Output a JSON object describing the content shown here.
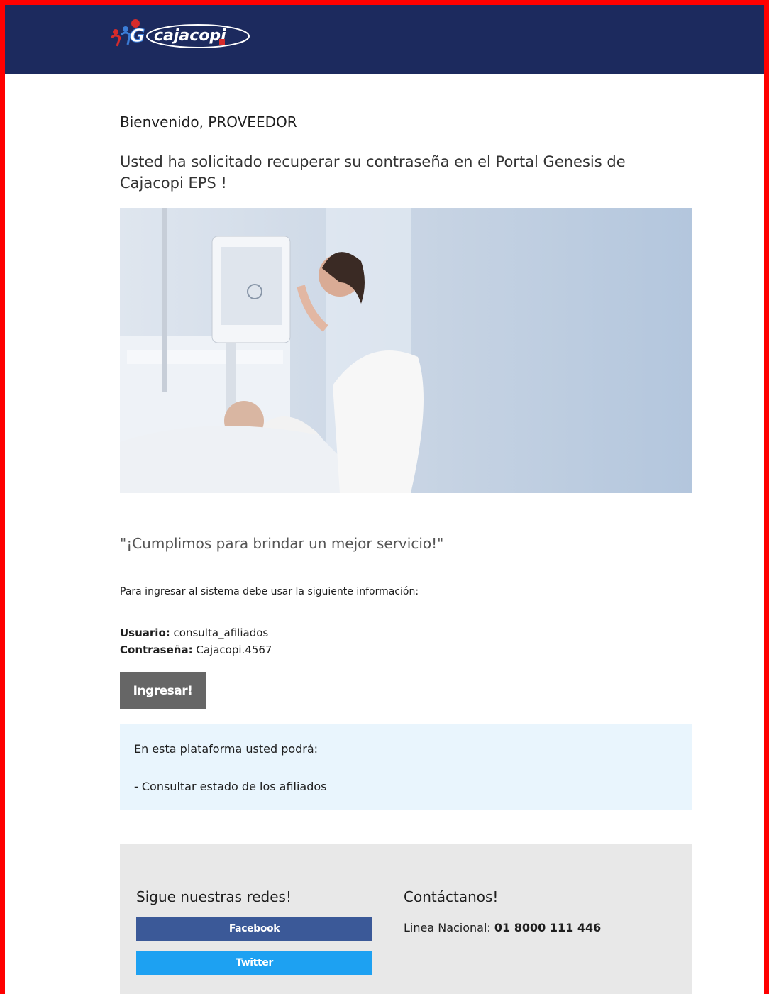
{
  "header": {
    "logo_text": "cajacopi",
    "logo_initial": "G",
    "brand_color": "#1c2a5e"
  },
  "email": {
    "greeting": "Bienvenido, PROVEEDOR",
    "intro": "Usted ha solicitado recuperar su contraseña en el Portal Genesis de Cajacopi EPS !",
    "slogan": "\"¡Cumplimos para brindar un mejor servicio!\"",
    "instructions": "Para ingresar al sistema debe usar la siguiente información:",
    "user_label": "Usuario:",
    "user_value": "consulta_afiliados",
    "password_label": "Contraseña:",
    "password_value": "Cajacopi.4567",
    "login_button": "Ingresar!"
  },
  "info_box": {
    "title": "En esta plataforma usted podrá:",
    "item": "- Consultar estado de los afiliados"
  },
  "footer": {
    "social_title": "Sigue nuestras redes!",
    "facebook_label": "Facebook",
    "twitter_label": "Twitter",
    "contact_title": "Contáctanos!",
    "phone_label": "Linea Nacional:",
    "phone_value": "01 8000 111 446",
    "facebook_color": "#3b5998",
    "twitter_color": "#1da1f2"
  }
}
